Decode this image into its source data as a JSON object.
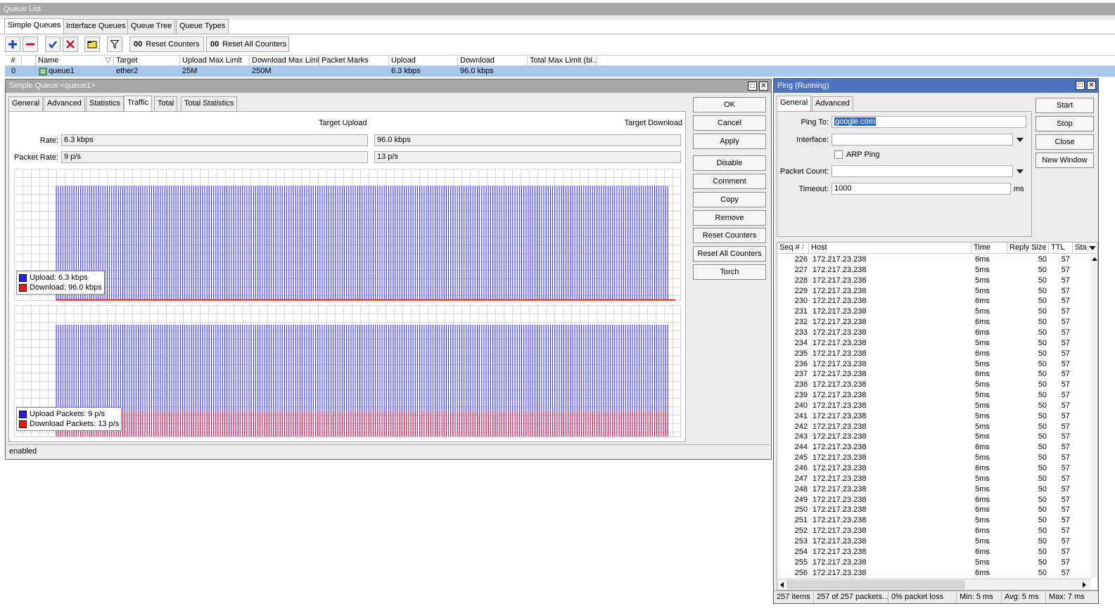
{
  "queue_list": {
    "title": "Queue List",
    "tabs": [
      "Simple Queues",
      "Interface Queues",
      "Queue Tree",
      "Queue Types"
    ],
    "toolbar": {
      "reset_counters": "Reset Counters",
      "reset_all_counters": "Reset All Counters",
      "counter_glyph": "00"
    },
    "columns": [
      "#",
      "Name",
      "Target",
      "Upload Max Limit",
      "Download Max Limit",
      "Packet Marks",
      "Upload",
      "Download",
      "Total Max Limit (bi..."
    ],
    "row": {
      "index": "0",
      "name": "queue1",
      "target": "ether2",
      "upload_max": "25M",
      "download_max": "250M",
      "packet_marks": "",
      "upload": "6.3 kbps",
      "download": "96.0 kbps",
      "total_max": ""
    }
  },
  "simple_queue": {
    "title": "Simple Queue <queue1>",
    "tabs": [
      "General",
      "Advanced",
      "Statistics",
      "Traffic",
      "Total",
      "Total Statistics"
    ],
    "target_upload_label": "Target Upload",
    "target_download_label": "Target Download",
    "rate_label": "Rate:",
    "rate_upload": "6.3 kbps",
    "rate_download": "96.0 kbps",
    "packet_rate_label": "Packet Rate:",
    "packet_rate_upload": "9 p/s",
    "packet_rate_download": "13 p/s",
    "chart1_legend": {
      "upload": "Upload:",
      "upload_value": "6.3 kbps",
      "download": "Download:",
      "download_value": "96.0 kbps"
    },
    "chart2_legend": {
      "upload": "Upload Packets:",
      "upload_value": "9 p/s",
      "download": "Download Packets:",
      "download_value": "13 p/s"
    },
    "buttons": [
      "OK",
      "Cancel",
      "Apply",
      "Disable",
      "Comment",
      "Copy",
      "Remove",
      "Reset Counters",
      "Reset All Counters",
      "Torch"
    ],
    "status": "enabled",
    "colors": {
      "upload": "#2020ff",
      "download": "#ff1010"
    }
  },
  "chart_data": [
    {
      "type": "bar",
      "chart": "traffic rate",
      "series": [
        {
          "name": "Upload",
          "level": 0.9,
          "color": "#2020ff"
        },
        {
          "name": "Download",
          "level": 0.0,
          "color": "#ff1010"
        }
      ],
      "grid": true,
      "legend": "bottom-left"
    },
    {
      "type": "bar",
      "chart": "packet rate",
      "series": [
        {
          "name": "Upload Packets",
          "level": 0.88,
          "color": "#2020ff"
        },
        {
          "name": "Download Packets",
          "level": 0.2,
          "color": "#ff1010"
        }
      ],
      "grid": true,
      "legend": "bottom-left"
    }
  ],
  "ping": {
    "title": "Ping (Running)",
    "tabs": [
      "General",
      "Advanced"
    ],
    "ping_to_label": "Ping To:",
    "ping_to_value": "google.com",
    "interface_label": "Interface:",
    "arp_ping_label": "ARP Ping",
    "packet_count_label": "Packet Count:",
    "timeout_label": "Timeout:",
    "timeout_value": "1000",
    "timeout_unit": "ms",
    "buttons": [
      "Start",
      "Stop",
      "Close",
      "New Window"
    ],
    "columns": [
      "Seq #",
      "Host",
      "Time",
      "Reply Size",
      "TTL",
      "Sta"
    ],
    "sort_indicator": "/",
    "rows": [
      {
        "seq": "226",
        "host": "172.217.23.238",
        "time": "6ms",
        "size": "50",
        "ttl": "57"
      },
      {
        "seq": "227",
        "host": "172.217.23.238",
        "time": "5ms",
        "size": "50",
        "ttl": "57"
      },
      {
        "seq": "228",
        "host": "172.217.23.238",
        "time": "5ms",
        "size": "50",
        "ttl": "57"
      },
      {
        "seq": "229",
        "host": "172.217.23.238",
        "time": "5ms",
        "size": "50",
        "ttl": "57"
      },
      {
        "seq": "230",
        "host": "172.217.23.238",
        "time": "6ms",
        "size": "50",
        "ttl": "57"
      },
      {
        "seq": "231",
        "host": "172.217.23.238",
        "time": "5ms",
        "size": "50",
        "ttl": "57"
      },
      {
        "seq": "232",
        "host": "172.217.23.238",
        "time": "6ms",
        "size": "50",
        "ttl": "57"
      },
      {
        "seq": "233",
        "host": "172.217.23.238",
        "time": "6ms",
        "size": "50",
        "ttl": "57"
      },
      {
        "seq": "234",
        "host": "172.217.23.238",
        "time": "5ms",
        "size": "50",
        "ttl": "57"
      },
      {
        "seq": "235",
        "host": "172.217.23.238",
        "time": "6ms",
        "size": "50",
        "ttl": "57"
      },
      {
        "seq": "236",
        "host": "172.217.23.238",
        "time": "5ms",
        "size": "50",
        "ttl": "57"
      },
      {
        "seq": "237",
        "host": "172.217.23.238",
        "time": "6ms",
        "size": "50",
        "ttl": "57"
      },
      {
        "seq": "238",
        "host": "172.217.23.238",
        "time": "5ms",
        "size": "50",
        "ttl": "57"
      },
      {
        "seq": "239",
        "host": "172.217.23.238",
        "time": "5ms",
        "size": "50",
        "ttl": "57"
      },
      {
        "seq": "240",
        "host": "172.217.23.238",
        "time": "5ms",
        "size": "50",
        "ttl": "57"
      },
      {
        "seq": "241",
        "host": "172.217.23.238",
        "time": "5ms",
        "size": "50",
        "ttl": "57"
      },
      {
        "seq": "242",
        "host": "172.217.23.238",
        "time": "5ms",
        "size": "50",
        "ttl": "57"
      },
      {
        "seq": "243",
        "host": "172.217.23.238",
        "time": "5ms",
        "size": "50",
        "ttl": "57"
      },
      {
        "seq": "244",
        "host": "172.217.23.238",
        "time": "6ms",
        "size": "50",
        "ttl": "57"
      },
      {
        "seq": "245",
        "host": "172.217.23.238",
        "time": "5ms",
        "size": "50",
        "ttl": "57"
      },
      {
        "seq": "246",
        "host": "172.217.23.238",
        "time": "6ms",
        "size": "50",
        "ttl": "57"
      },
      {
        "seq": "247",
        "host": "172.217.23.238",
        "time": "5ms",
        "size": "50",
        "ttl": "57"
      },
      {
        "seq": "248",
        "host": "172.217.23.238",
        "time": "5ms",
        "size": "50",
        "ttl": "57"
      },
      {
        "seq": "249",
        "host": "172.217.23.238",
        "time": "6ms",
        "size": "50",
        "ttl": "57"
      },
      {
        "seq": "250",
        "host": "172.217.23.238",
        "time": "6ms",
        "size": "50",
        "ttl": "57"
      },
      {
        "seq": "251",
        "host": "172.217.23.238",
        "time": "5ms",
        "size": "50",
        "ttl": "57"
      },
      {
        "seq": "252",
        "host": "172.217.23.238",
        "time": "6ms",
        "size": "50",
        "ttl": "57"
      },
      {
        "seq": "253",
        "host": "172.217.23.238",
        "time": "5ms",
        "size": "50",
        "ttl": "57"
      },
      {
        "seq": "254",
        "host": "172.217.23.238",
        "time": "6ms",
        "size": "50",
        "ttl": "57"
      },
      {
        "seq": "255",
        "host": "172.217.23.238",
        "time": "5ms",
        "size": "50",
        "ttl": "57"
      },
      {
        "seq": "256",
        "host": "172.217.23.238",
        "time": "6ms",
        "size": "50",
        "ttl": "57"
      }
    ],
    "status": {
      "items": "257 items",
      "packets": "257 of 257 packets...",
      "loss": "0% packet loss",
      "min": "Min: 5 ms",
      "avg": "Avg: 5 ms",
      "max": "Max: 7 ms"
    }
  }
}
